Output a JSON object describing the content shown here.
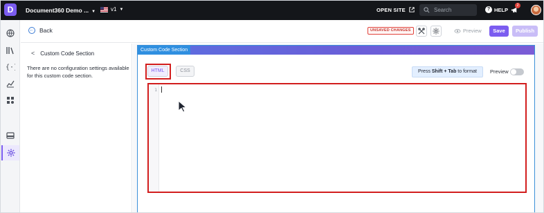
{
  "topbar": {
    "logo_letter": "D",
    "project_name": "Document360 Demo ...",
    "version": "v1",
    "open_site": "OPEN SITE",
    "search_placeholder": "Search",
    "help": "HELP",
    "notification_count": "2"
  },
  "rail": {
    "items": [
      "globe-icon",
      "library-icon",
      "code-braces-icon",
      "analytics-icon",
      "apps-icon",
      "template-icon",
      "settings-icon"
    ],
    "active": "settings-icon"
  },
  "actionbar": {
    "back": "Back",
    "unsaved": "UNSAVED CHANGES",
    "preview": "Preview",
    "save": "Save",
    "publish": "Publish"
  },
  "panel": {
    "title": "Custom Code Section",
    "message": "There are no configuration settings available for this custom code section."
  },
  "section": {
    "label": "Custom Code Section",
    "tabs": [
      {
        "label": "HTML",
        "selected": true
      },
      {
        "label": "CSS",
        "selected": false
      }
    ],
    "format_hint_prefix": "Press ",
    "format_hint_keys": "Shift + Tab",
    "format_hint_suffix": " to format",
    "preview_label": "Preview",
    "preview_enabled": false,
    "editor": {
      "line_numbers": [
        "1"
      ],
      "content": ""
    }
  },
  "colors": {
    "accent": "#7b5cf0",
    "highlight": "#d21d1d",
    "section_border": "#3a8fd8"
  }
}
